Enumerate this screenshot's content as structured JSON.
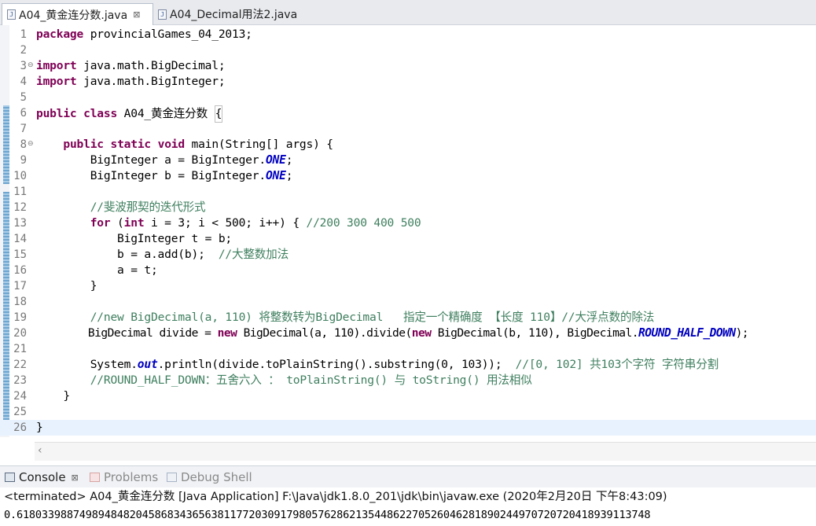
{
  "editor_tabs": [
    {
      "label": "A04_黄金连分数.java",
      "close": "⊠",
      "active": true
    },
    {
      "label": "A04_Decimal用法2.java",
      "active": false
    }
  ],
  "code_lines": [
    {
      "n": "1",
      "text": "package provincialGames_04_2013;"
    },
    {
      "n": "2",
      "text": ""
    },
    {
      "n": "3",
      "text": "import java.math.BigDecimal;"
    },
    {
      "n": "4",
      "text": "import java.math.BigInteger;"
    },
    {
      "n": "5",
      "text": ""
    },
    {
      "n": "6",
      "text": "public class A04_黄金连分数 {"
    },
    {
      "n": "7",
      "text": ""
    },
    {
      "n": "8",
      "text": "    public static void main(String[] args) {"
    },
    {
      "n": "9",
      "text": "        BigInteger a = BigInteger.ONE;"
    },
    {
      "n": "10",
      "text": "        BigInteger b = BigInteger.ONE;"
    },
    {
      "n": "11",
      "text": ""
    },
    {
      "n": "12",
      "text": "        //斐波那契的迭代形式"
    },
    {
      "n": "13",
      "text": "        for (int i = 3; i < 500; i++) { //200 300 400 500"
    },
    {
      "n": "14",
      "text": "            BigInteger t = b;"
    },
    {
      "n": "15",
      "text": "            b = a.add(b);  //大整数加法"
    },
    {
      "n": "16",
      "text": "            a = t;"
    },
    {
      "n": "17",
      "text": "        }"
    },
    {
      "n": "18",
      "text": ""
    },
    {
      "n": "19",
      "text": "        //new BigDecimal(a, 110) 将整数转为BigDecimal   指定一个精确度 【长度 110】//大浮点数的除法"
    },
    {
      "n": "20",
      "text": "        BigDecimal divide = new BigDecimal(a, 110).divide(new BigDecimal(b, 110), BigDecimal.ROUND_HALF_DOWN);"
    },
    {
      "n": "21",
      "text": ""
    },
    {
      "n": "22",
      "text": "        System.out.println(divide.toPlainString().substring(0, 103));  //[0, 102] 共103个字符 字符串分割"
    },
    {
      "n": "23",
      "text": "        //ROUND_HALF_DOWN：五舍六入 ： toPlainString() 与 toString() 用法相似"
    },
    {
      "n": "24",
      "text": "    }"
    },
    {
      "n": "25",
      "text": ""
    },
    {
      "n": "26",
      "text": "}"
    }
  ],
  "console_tabs": [
    {
      "label": "Console",
      "close": "⊠",
      "active": true
    },
    {
      "label": "Problems",
      "active": false
    },
    {
      "label": "Debug Shell",
      "active": false
    }
  ],
  "console": {
    "status": "<terminated> A04_黄金连分数 [Java Application] F:\\Java\\jdk1.8.0_201\\jdk\\bin\\javaw.exe (2020年2月20日 下午8:43:09)",
    "output": "0.6180339887498948482045868343656381177203091798057628621354486227052604628189024497072072041893911374​8"
  },
  "colors": {
    "keyword": "#7f0055",
    "comment": "#3f7f5f",
    "static_field": "#0000c0",
    "current_line": "#e8f2fe"
  },
  "icons": [
    "java-file-icon",
    "close-icon",
    "fold-icon",
    "console-icon",
    "problems-icon",
    "debug-shell-icon",
    "scroll-left-icon"
  ]
}
